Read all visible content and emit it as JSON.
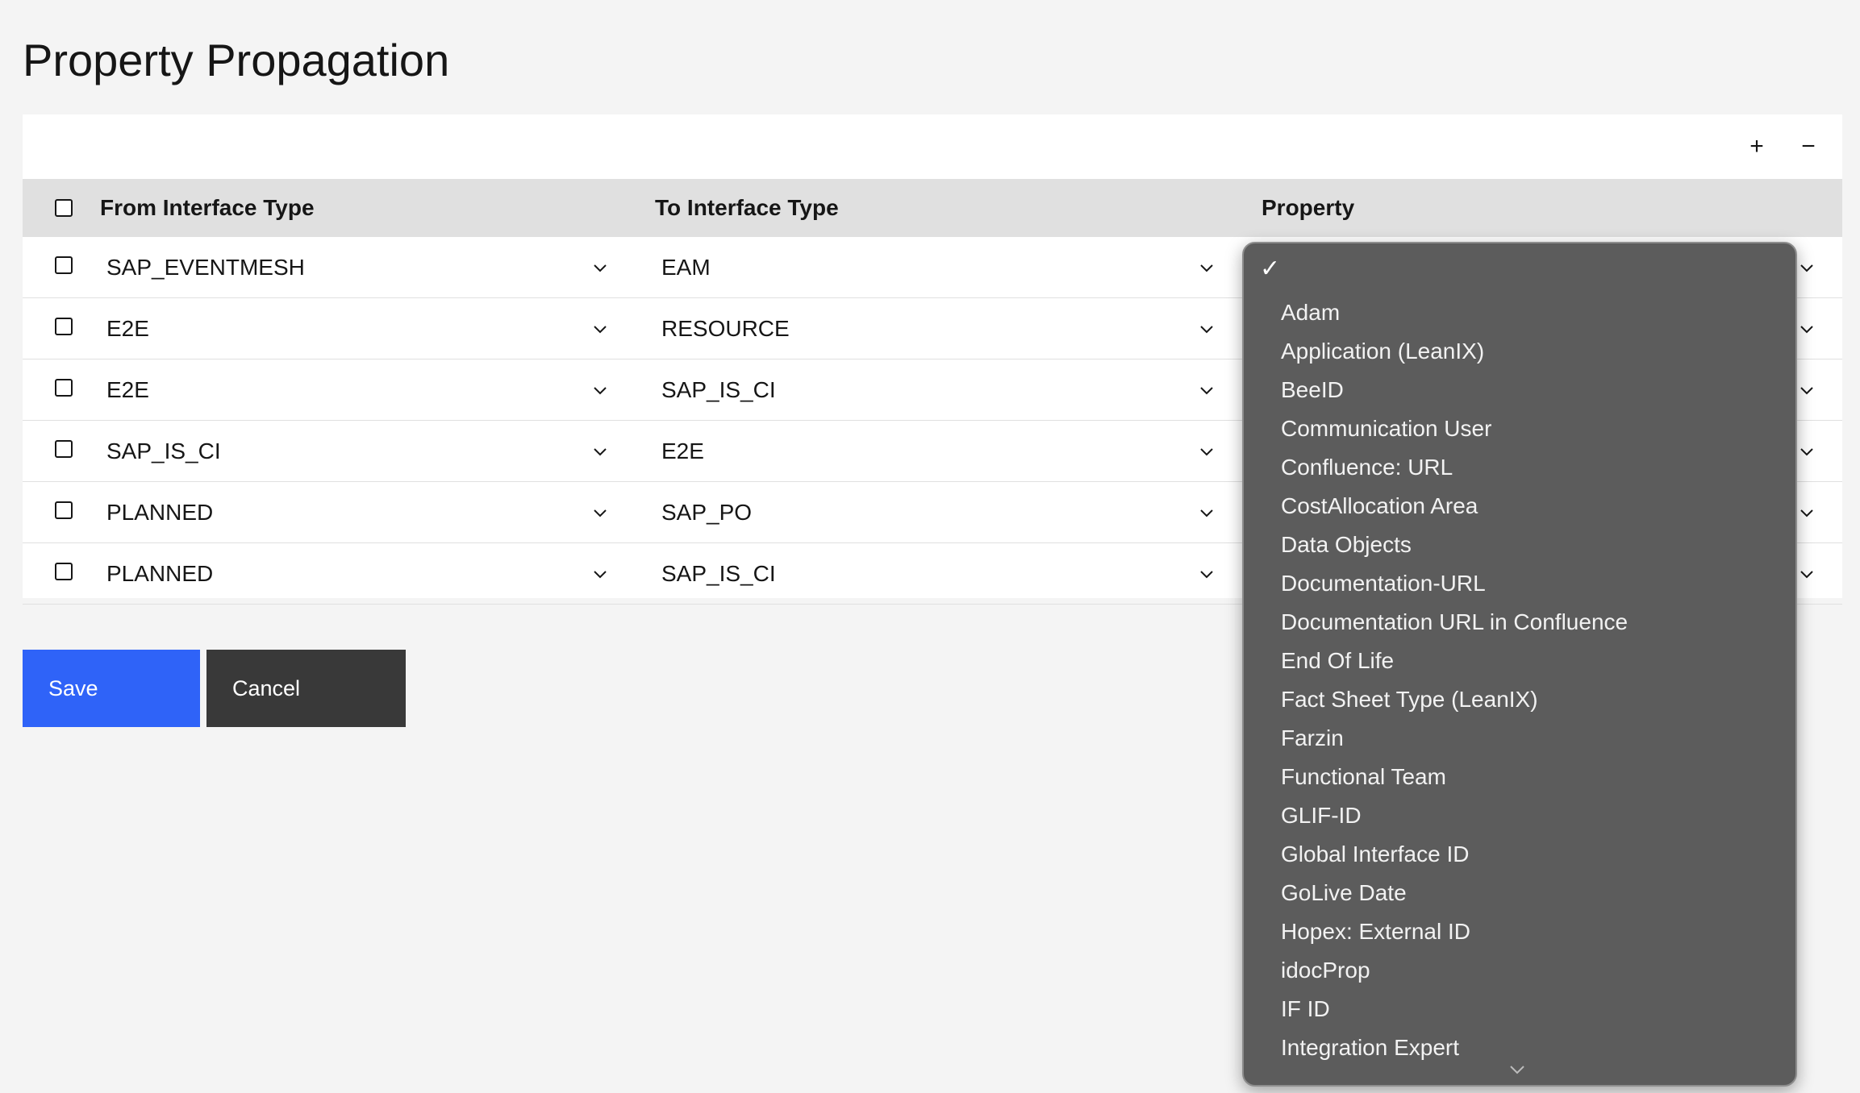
{
  "page": {
    "title": "Property Propagation"
  },
  "toolbar": {
    "add_label": "+",
    "remove_label": "−"
  },
  "table": {
    "headers": {
      "from": "From Interface Type",
      "to": "To Interface Type",
      "property": "Property"
    },
    "rows": [
      {
        "from": "SAP_EVENTMESH",
        "to": "EAM"
      },
      {
        "from": "E2E",
        "to": "RESOURCE"
      },
      {
        "from": "E2E",
        "to": "SAP_IS_CI"
      },
      {
        "from": "SAP_IS_CI",
        "to": "E2E"
      },
      {
        "from": "PLANNED",
        "to": "SAP_PO"
      },
      {
        "from": "PLANNED",
        "to": "SAP_IS_CI"
      }
    ]
  },
  "actions": {
    "save_label": "Save",
    "cancel_label": "Cancel"
  },
  "dropdown": {
    "checkmark": "✓",
    "options": [
      "Adam",
      "Application (LeanIX)",
      "BeeID",
      "Communication User",
      "Confluence: URL",
      "CostAllocation Area",
      "Data Objects",
      "Documentation-URL",
      "Documentation URL in Confluence",
      "End Of Life",
      "Fact Sheet Type (LeanIX)",
      "Farzin",
      "Functional Team",
      "GLIF-ID",
      "Global Interface ID",
      "GoLive Date",
      "Hopex: External ID",
      "idocProp",
      "IF ID",
      "Integration Expert"
    ]
  },
  "colors": {
    "save": "#2f63f8",
    "cancel": "#393939",
    "header_bg": "#e0e0e0",
    "dropdown_bg": "#5c5c5c"
  }
}
